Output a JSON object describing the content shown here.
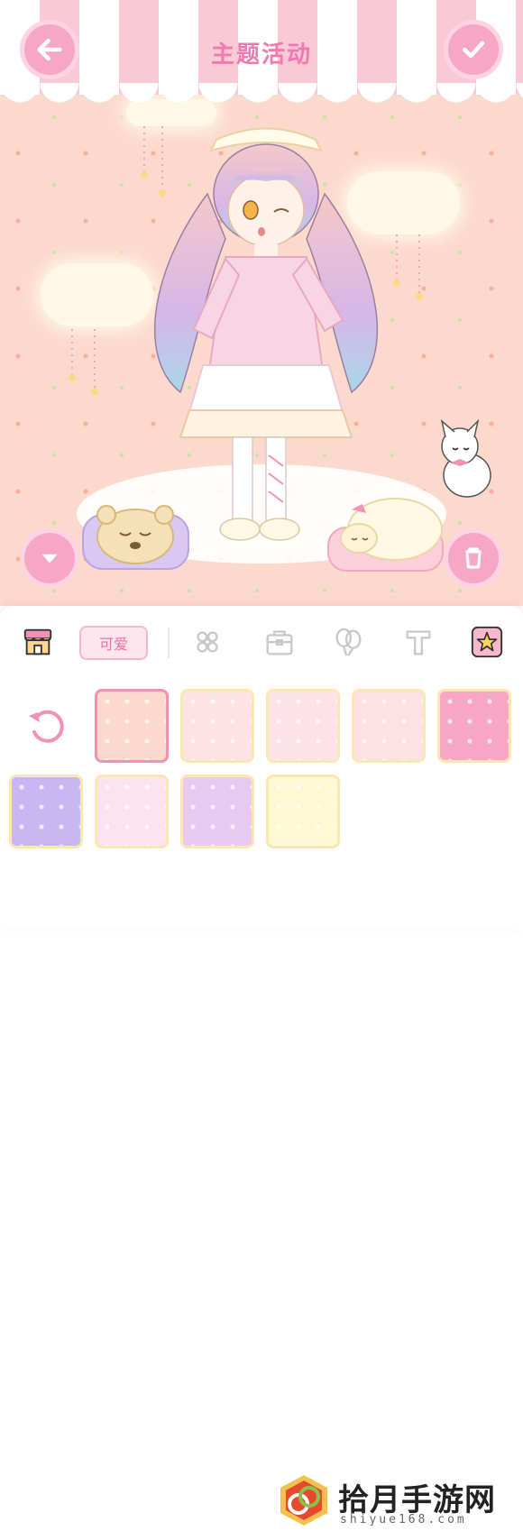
{
  "header": {
    "title": "主题活动"
  },
  "tabs": {
    "cute_label": "可爱",
    "items": [
      {
        "icon": "shop-icon"
      },
      {
        "icon": "flower-icon"
      },
      {
        "icon": "bag-icon"
      },
      {
        "icon": "balloon-icon"
      },
      {
        "icon": "text-icon"
      },
      {
        "icon": "star-icon"
      }
    ]
  },
  "backgrounds": [
    {
      "name": "carrot-peach",
      "color": "#fcd9cd",
      "selected": true
    },
    {
      "name": "strawberry-pink",
      "color": "#fde2e6",
      "selected": false
    },
    {
      "name": "dots-pink",
      "color": "#fde3e8",
      "selected": false
    },
    {
      "name": "apple-pink",
      "color": "#fde1e4",
      "selected": false
    },
    {
      "name": "bunny-pink",
      "color": "#f7a7c3",
      "selected": false
    },
    {
      "name": "bunny-lavender",
      "color": "#c7b8f3",
      "selected": false
    },
    {
      "name": "star-pink",
      "color": "#fbe3ef",
      "selected": false
    },
    {
      "name": "star-lilac",
      "color": "#e7c9f2",
      "selected": false
    },
    {
      "name": "flower-cream",
      "color": "#fef8d4",
      "selected": false
    }
  ],
  "watermark": {
    "title": "拾月手游网",
    "subtitle": "shiyue168.com"
  },
  "colors": {
    "accent": "#f290b5",
    "stage": "#fcd9cd"
  }
}
